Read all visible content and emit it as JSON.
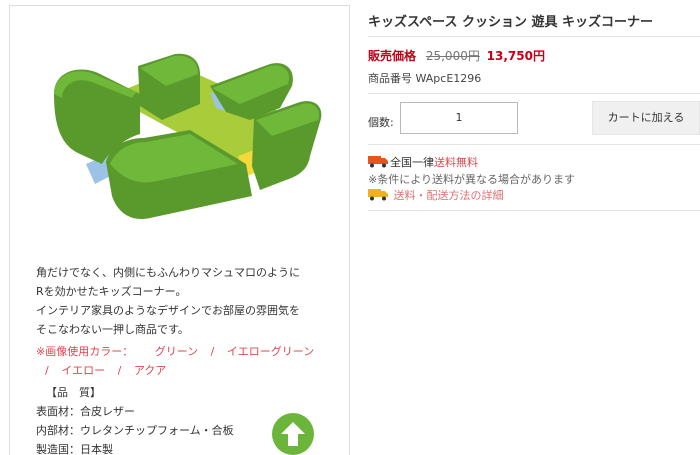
{
  "product": {
    "title": "キッズスペース クッション 遊具 キッズコーナー",
    "price_label": "販売価格",
    "price_old": "25,000円",
    "price_new": "13,750円",
    "sku": "商品番号 WApcE1296"
  },
  "purchase": {
    "qty_label": "個数:",
    "qty_value": "1",
    "cart_button": "カートに加える"
  },
  "shipping": {
    "line1_prefix": "全国一律",
    "line1_highlight": "送料無料",
    "line2": "※条件により送料が異なる場合があります",
    "details_link": "送料・配送方法の詳細"
  },
  "description": {
    "lines": [
      "角だけでなく、内側にもふんわりマシュマロのように",
      "Rを効かせたキッズコーナー。",
      "インテリア家具のようなデザインでお部屋の雰囲気を",
      "そこなわない一押し商品です。"
    ],
    "colors_label": "※画像使用カラー：",
    "colors": [
      "グリーン",
      "イエローグリーン",
      "イエロー",
      "アクア"
    ],
    "specs_heading": "【品　質】",
    "specs": [
      "表面材：合皮レザー",
      "内部材：ウレタンチップフォーム・合板",
      "製造国：日本製"
    ]
  },
  "icons": {
    "shipping": "truck-icon",
    "scroll_top": "arrow-up-icon"
  },
  "colors_theme": {
    "price_red": "#c40018",
    "link_red": "#e0454f",
    "scroll_green": "#6bb53a"
  }
}
